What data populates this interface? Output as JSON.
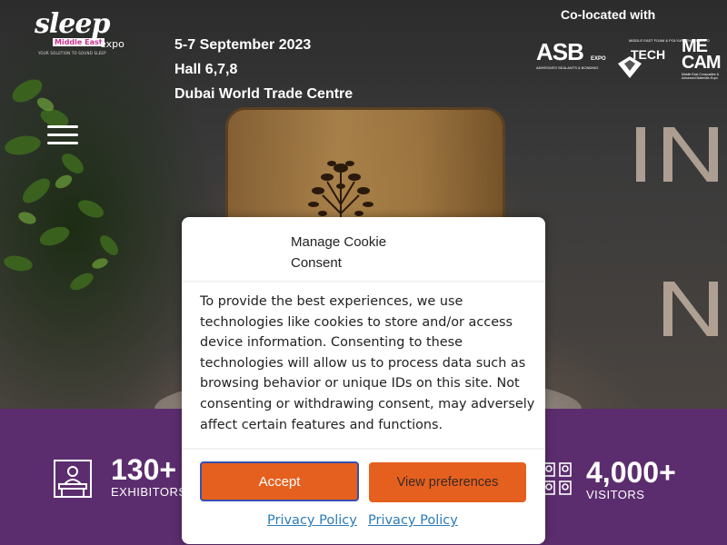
{
  "header": {
    "logo": {
      "word": "sleep",
      "region": "Middle East",
      "suffix": "expo",
      "tagline": "YOUR SOLUTION TO SOUND SLEEP"
    },
    "event_info": {
      "dates": "5-7 September 2023",
      "hall": "Hall 6,7,8",
      "venue": "Dubai World Trade Centre"
    },
    "colocated": {
      "title": "Co-located with",
      "partners": [
        {
          "name": "ASB",
          "sub": "ADHESIVES SEALANTS & BONDING",
          "tag": "EXPO"
        },
        {
          "name": "TECH",
          "sub": "MIDDLE EAST FOAM & POLYURETHANE EXPO"
        },
        {
          "name": "ME CAM",
          "sub": "Middle East Composites & Advanced Materials Expo"
        }
      ]
    }
  },
  "stats": {
    "exhibitors": {
      "number": "130+",
      "label": "EXHIBITORS"
    },
    "visitors": {
      "number": "4,000+",
      "label": "VISITORS"
    }
  },
  "cookie_modal": {
    "title": "Manage Cookie Consent",
    "body": "To provide the best experiences, we use technologies like cookies to store and/or access device information. Consenting to these technologies will allow us to process data such as browsing behavior or unique IDs on this site. Not consenting or withdrawing consent, may adversely affect certain features and functions.",
    "accept_label": "Accept",
    "preferences_label": "View preferences",
    "privacy_links": [
      "Privacy Policy",
      "Privacy Policy"
    ]
  },
  "colors": {
    "accent": "#e5601e",
    "stats_bg": "#5c2d6e",
    "link": "#2b7bb9",
    "logo_magenta": "#c8308c"
  },
  "icons": [
    "hamburger-menu-icon",
    "exhibitor-booth-icon",
    "visitors-icon"
  ]
}
